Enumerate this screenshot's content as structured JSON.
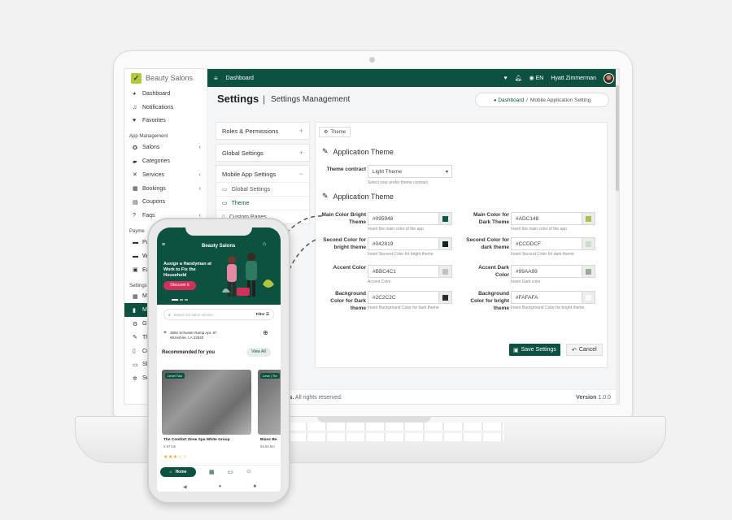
{
  "app": {
    "brand": "Beauty Salons",
    "topbar": {
      "title": "Dashboard",
      "lang": "EN",
      "user": "Hyatt Zimmerman"
    },
    "header": {
      "title": "Settings",
      "sep": "|",
      "subtitle": "Settings Management"
    },
    "breadcrumb": {
      "home": "Dashboard",
      "sep": "/",
      "current": "Mobile Application Setting"
    },
    "sidebar": {
      "items_top": [
        {
          "label": "Dashboard",
          "icon": "palette-icon"
        },
        {
          "label": "Notifications",
          "icon": "bell-icon"
        },
        {
          "label": "Favorites",
          "icon": "heart-icon"
        }
      ],
      "section_app": "App Management",
      "items_app": [
        {
          "label": "Salons",
          "icon": "users-icon",
          "chev": "‹"
        },
        {
          "label": "Categories",
          "icon": "folder-icon",
          "chev": ""
        },
        {
          "label": "Services",
          "icon": "tools-icon",
          "chev": "‹"
        },
        {
          "label": "Bookings",
          "icon": "calendar-icon",
          "chev": "‹"
        },
        {
          "label": "Coupons",
          "icon": "ticket-icon",
          "chev": ""
        },
        {
          "label": "Faqs",
          "icon": "question-icon",
          "chev": "‹"
        }
      ],
      "section_pay": "Payme",
      "items_pay": [
        "Pa",
        "W",
        "Ea"
      ],
      "section_set": "Settings",
      "items_set": [
        "M",
        "Mo",
        "Gl",
        "Th",
        "Cu",
        "Sli",
        "Se"
      ]
    },
    "menu": {
      "roles": "Roles & Permissions",
      "global": "Global Settings",
      "mobile": "Mobile App Settings",
      "sub_items": [
        "Global Settings",
        "Theme",
        "Custom Pages"
      ],
      "plus": "+",
      "minus": "−"
    },
    "theme_tab": "Theme",
    "sections": {
      "app_theme_1": "Application Theme",
      "app_theme_2": "Application Theme"
    },
    "theme_contract": {
      "label": "Theme contract",
      "value": "Light Theme",
      "help": "Select your prefer theme contract"
    },
    "colors_left": [
      {
        "label": "Main Color Bright Theme",
        "value": "#095948",
        "help": "Insert the main color of the app",
        "swatch": "#095948"
      },
      {
        "label": "Second Color for bright theme",
        "value": "#042819",
        "help": "Insert Second Color for bright theme",
        "swatch": "#042819"
      },
      {
        "label": "Accent Color",
        "value": "#BBC4C1",
        "help": "Accent Color",
        "swatch": "#BBC4C1"
      },
      {
        "label": "Background Color for Dark theme",
        "value": "#2C2C2C",
        "help": "Insert Background Color for dark theme",
        "swatch": "#2C2C2C"
      }
    ],
    "colors_right": [
      {
        "label": "Main Color for Dark Theme",
        "value": "#ADC148",
        "help": "Insert the main color of the app",
        "swatch": "#ADC148"
      },
      {
        "label": "Second Color for dark theme",
        "value": "#CCDDCF",
        "help": "Insert Second Color for dark theme",
        "swatch": "#CCDDCF"
      },
      {
        "label": "Accent Dark Color",
        "value": "#99AA99",
        "help": "Insert Dark color",
        "swatch": "#99AA99"
      },
      {
        "label": "Background Color for bright theme",
        "value": "#FAFAFA",
        "help": "Insert Background Color for bright theme",
        "swatch": "#FAFAFA"
      }
    ],
    "buttons": {
      "save": "Save Settings",
      "cancel": "Cancel"
    },
    "footer": {
      "brand": "lons.",
      "text": "All rights reserved.",
      "version_label": "Version",
      "version": "1.0.0"
    }
  },
  "phone": {
    "title": "Beauty Salons",
    "hero_text": "Assign a Handyman at Work to Fix the Household",
    "hero_button": "Discover it",
    "search_placeholder": "Search for salon service...",
    "filter": "Filter",
    "address": "3892 Schuster Ramp Apt. 87 Wizeshire, LA 22540",
    "recommended": "Recommended for you",
    "view_all": "View All",
    "tag1": "Level Two",
    "tag2": "Leve | Thr",
    "salon1": "The Comfort Zone Spa White Group",
    "dist1": "0.97 km",
    "salon2": "Blanc Be",
    "dist2": "53.82 km",
    "stars": "★★★☆☆",
    "nav_home": "Home"
  },
  "colors": {
    "primary": "#0d5140",
    "accent": "#b4c639",
    "pink": "#d0315b"
  }
}
